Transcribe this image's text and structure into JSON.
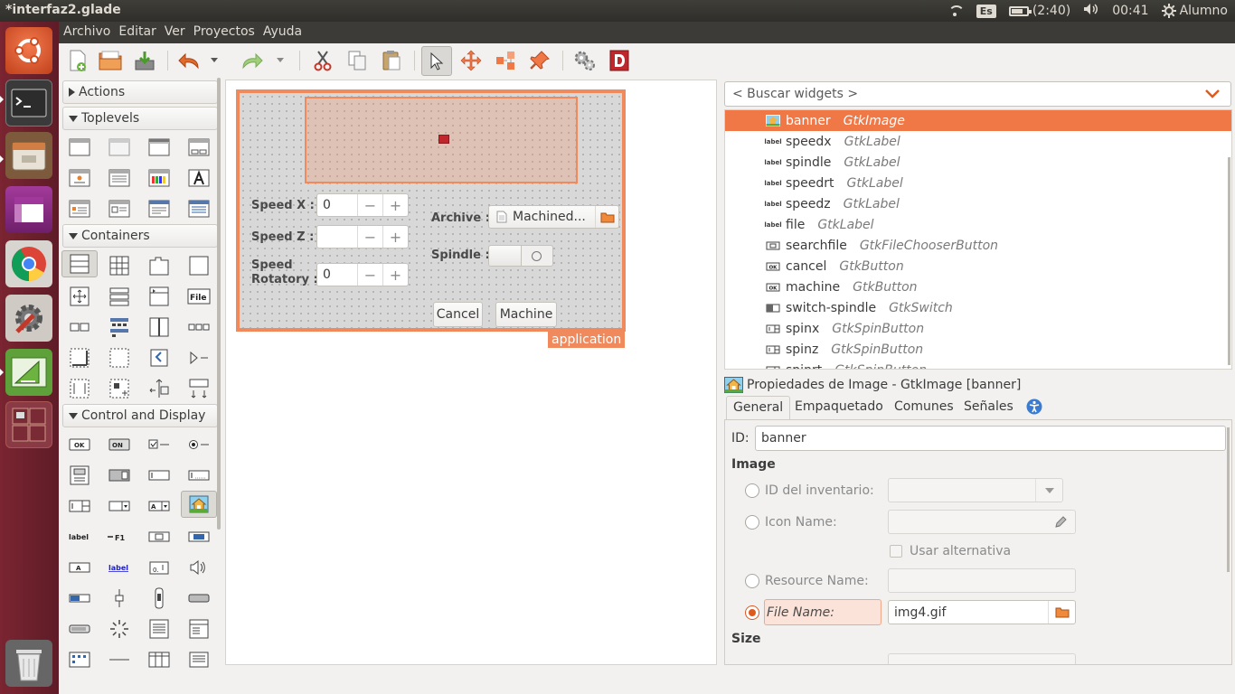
{
  "window": {
    "title": "*interfaz2.glade"
  },
  "panel": {
    "keyboard": "Es",
    "battery": "(2:40)",
    "time": "00:41",
    "user": "Alumno"
  },
  "menu": [
    "Archivo",
    "Editar",
    "Ver",
    "Proyectos",
    "Ayuda"
  ],
  "palette": {
    "groups": [
      "Actions",
      "Toplevels",
      "Containers",
      "Control and Display"
    ]
  },
  "canvas": {
    "window_name": "application",
    "speedx_label": "Speed X :",
    "speedx_value": "0",
    "speedz_label": "Speed Z :",
    "speedz_value": "",
    "speedrt_label_1": "Speed",
    "speedrt_label_2": "Rotatory :",
    "speedrt_value": "0",
    "archive_label": "Archive :",
    "archive_value": "Machined...",
    "spindle_label": "Spindle :",
    "cancel_label": "Cancel",
    "machine_label": "Machine",
    "minus": "−",
    "plus": "+"
  },
  "inspector": {
    "search_placeholder": "< Buscar widgets >",
    "tree": [
      {
        "name": "banner",
        "type": "GtkImage",
        "icon": "img"
      },
      {
        "name": "speedx",
        "type": "GtkLabel",
        "icon": "label"
      },
      {
        "name": "spindle",
        "type": "GtkLabel",
        "icon": "label"
      },
      {
        "name": "speedrt",
        "type": "GtkLabel",
        "icon": "label"
      },
      {
        "name": "speedz",
        "type": "GtkLabel",
        "icon": "label"
      },
      {
        "name": "file",
        "type": "GtkLabel",
        "icon": "label"
      },
      {
        "name": "searchfile",
        "type": "GtkFileChooserButton",
        "icon": "file"
      },
      {
        "name": "cancel",
        "type": "GtkButton",
        "icon": "ok"
      },
      {
        "name": "machine",
        "type": "GtkButton",
        "icon": "ok"
      },
      {
        "name": "switch-spindle",
        "type": "GtkSwitch",
        "icon": "switch"
      },
      {
        "name": "spinx",
        "type": "GtkSpinButton",
        "icon": "spin"
      },
      {
        "name": "spinz",
        "type": "GtkSpinButton",
        "icon": "spin"
      },
      {
        "name": "spinrt",
        "type": "GtkSpinButton",
        "icon": "spin"
      }
    ]
  },
  "properties": {
    "title": "Propiedades de Image - GtkImage [banner]",
    "tabs": [
      "General",
      "Empaquetado",
      "Comunes",
      "Señales"
    ],
    "id_label": "ID:",
    "id_value": "banner",
    "section_image": "Image",
    "stock_label": "ID del inventario:",
    "icon_name_label": "Icon Name:",
    "use_fallback_label": "Usar alternativa",
    "resource_label": "Resource Name:",
    "file_name_label": "File Name:",
    "file_name_value": "img4.gif",
    "section_size": "Size"
  },
  "colors": {
    "accent": "#f07746",
    "launcher": "#6e2130",
    "selection": "#f08a5d"
  }
}
